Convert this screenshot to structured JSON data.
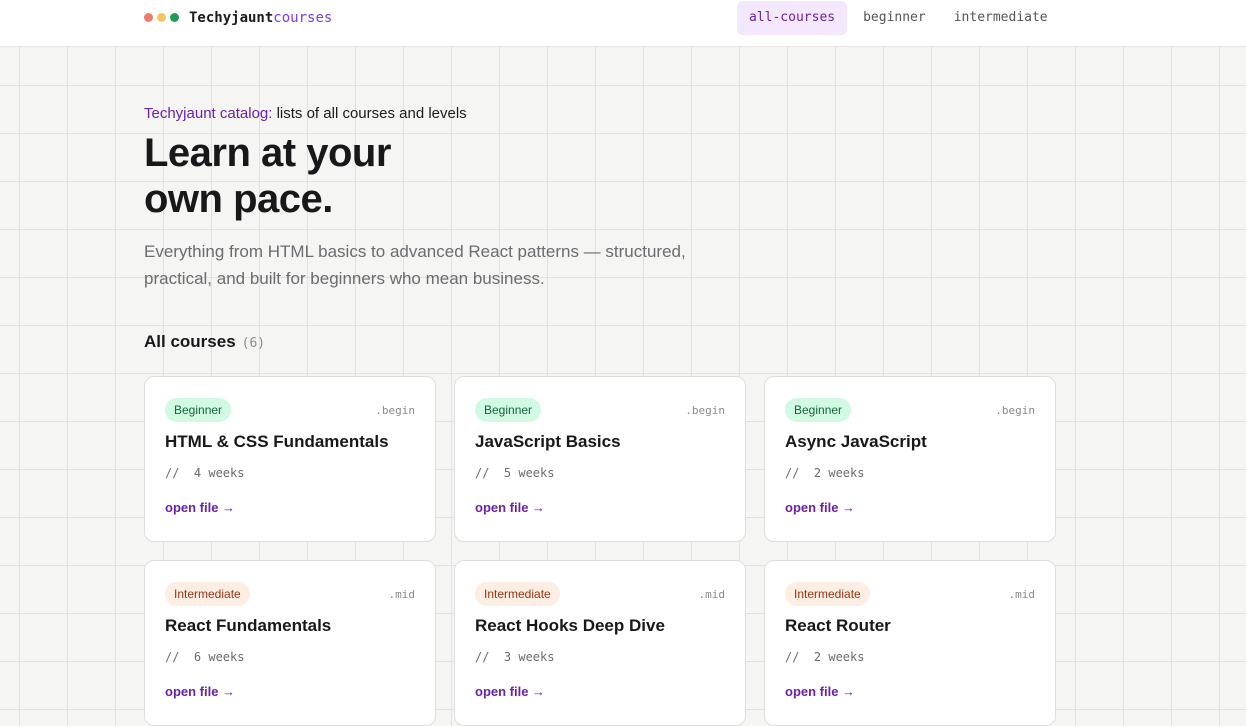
{
  "colors": {
    "accent": "#6b21a8",
    "dot_red": "#f07a6e",
    "dot_yellow": "#f2c661",
    "dot_green": "#1f9d55",
    "beginner_bg": "#d1fae5",
    "intermediate_bg": "#fdeee3"
  },
  "header": {
    "brand_name": "Techyjaunt",
    "brand_suffix": "courses",
    "nav": [
      {
        "label": "all-courses",
        "active": true
      },
      {
        "label": "beginner",
        "active": false
      },
      {
        "label": "intermediate",
        "active": false
      }
    ]
  },
  "hero": {
    "eyebrow_accent": "Techyjaunt catalog:",
    "eyebrow_text": " lists of all courses and levels",
    "title_line1": "Learn at your",
    "title_line2": "own pace.",
    "subtitle": "Everything from HTML basics to advanced React patterns — structured, practical, and built for beginners who mean business."
  },
  "courses_section": {
    "title": "All courses",
    "count": "(6)"
  },
  "courses": [
    {
      "badge": "Beginner",
      "level": "beginner",
      "slug": ".begin",
      "title": "HTML & CSS Fundamentals",
      "meta": "//  4 weeks",
      "link": "open file →"
    },
    {
      "badge": "Beginner",
      "level": "beginner",
      "slug": ".begin",
      "title": "JavaScript Basics",
      "meta": "//  5 weeks",
      "link": "open file →"
    },
    {
      "badge": "Beginner",
      "level": "beginner",
      "slug": ".begin",
      "title": "Async JavaScript",
      "meta": "//  2 weeks",
      "link": "open file →"
    },
    {
      "badge": "Intermediate",
      "level": "intermediate",
      "slug": ".mid",
      "title": "React Fundamentals",
      "meta": "//  6 weeks",
      "link": "open file →"
    },
    {
      "badge": "Intermediate",
      "level": "intermediate",
      "slug": ".mid",
      "title": "React Hooks Deep Dive",
      "meta": "//  3 weeks",
      "link": "open file →"
    },
    {
      "badge": "Intermediate",
      "level": "intermediate",
      "slug": ".mid",
      "title": "React Router",
      "meta": "//  2 weeks",
      "link": "open file →"
    }
  ]
}
